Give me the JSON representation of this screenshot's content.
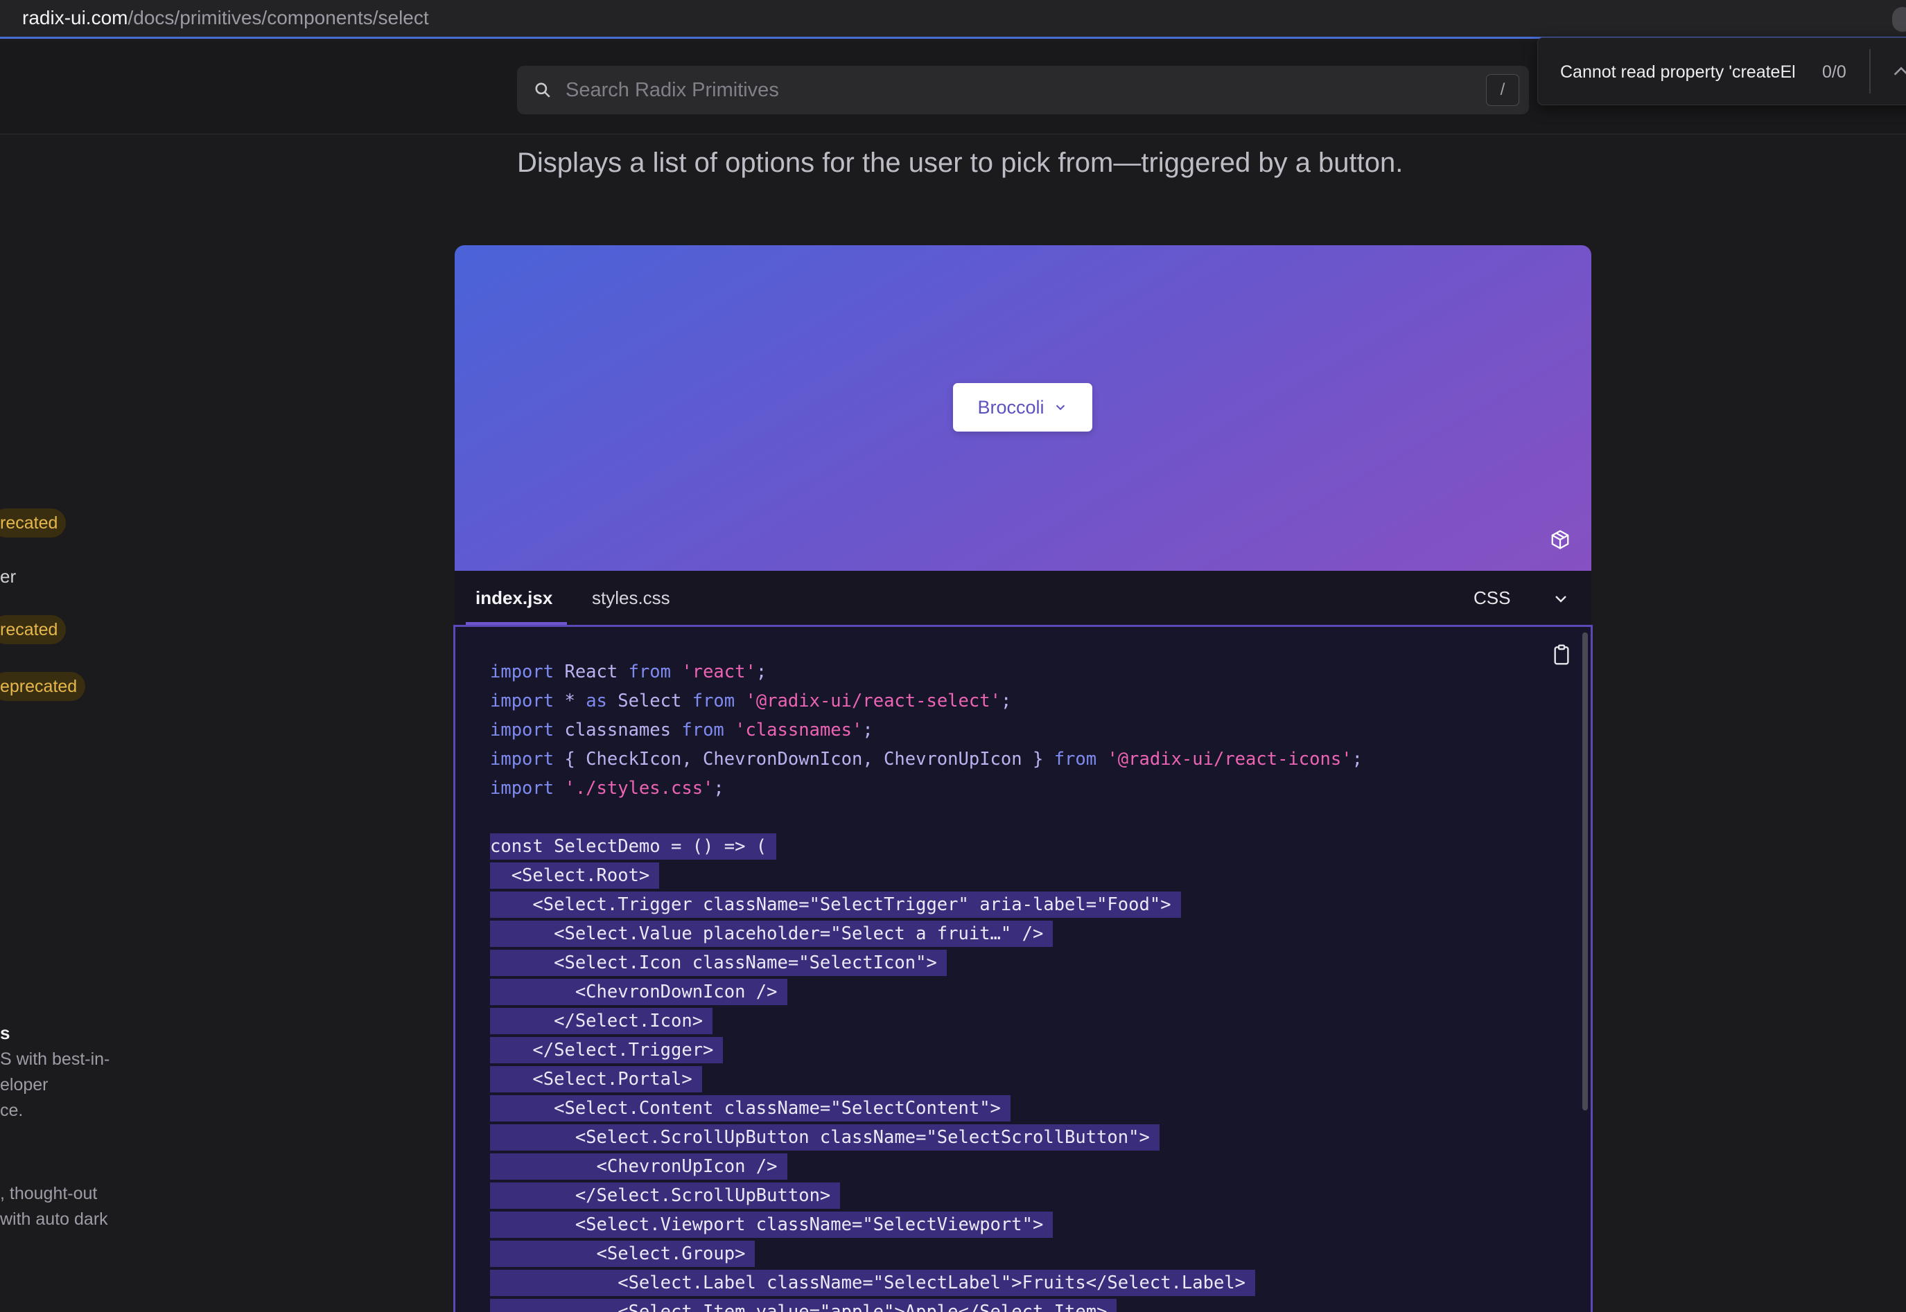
{
  "browser": {
    "url_host": "radix-ui.com",
    "url_path": "/docs/primitives/components/select"
  },
  "header": {
    "search_placeholder": "Search Radix Primitives",
    "search_shortcut": "/"
  },
  "toast": {
    "message": "Cannot read property 'createEl",
    "count": "0/0"
  },
  "sidebar": {
    "badge_1": "recated",
    "item_er": "er",
    "badge_2": "recated",
    "badge_3": "eprecated",
    "card_1_title": "s",
    "card_1_lines": [
      "S with best-in-",
      "eloper",
      "ce."
    ],
    "card_2_lines": [
      ", thought-out",
      "with auto dark"
    ]
  },
  "page": {
    "description": "Displays a list of options for the user to pick from—triggered by a button."
  },
  "demo": {
    "trigger_label": "Broccoli",
    "gradient_colors": [
      "#4b63d8",
      "#6a56cc",
      "#8651c2"
    ]
  },
  "code_tabs": {
    "tabs": [
      "index.jsx",
      "styles.css"
    ],
    "active_tab": "index.jsx",
    "language": "CSS"
  },
  "code": {
    "imports": [
      [
        {
          "t": "import ",
          "c": "kw"
        },
        {
          "t": "React ",
          "c": "plain"
        },
        {
          "t": "from ",
          "c": "kw"
        },
        {
          "t": "'react'",
          "c": "str"
        },
        {
          "t": ";",
          "c": "plain"
        }
      ],
      [
        {
          "t": "import ",
          "c": "kw"
        },
        {
          "t": "* ",
          "c": "plain"
        },
        {
          "t": "as ",
          "c": "kw"
        },
        {
          "t": "Select ",
          "c": "plain"
        },
        {
          "t": "from ",
          "c": "kw"
        },
        {
          "t": "'@radix-ui/react-select'",
          "c": "str"
        },
        {
          "t": ";",
          "c": "plain"
        }
      ],
      [
        {
          "t": "import ",
          "c": "kw"
        },
        {
          "t": "classnames ",
          "c": "plain"
        },
        {
          "t": "from ",
          "c": "kw"
        },
        {
          "t": "'classnames'",
          "c": "str"
        },
        {
          "t": ";",
          "c": "plain"
        }
      ],
      [
        {
          "t": "import ",
          "c": "kw"
        },
        {
          "t": "{ CheckIcon, ChevronDownIcon, ChevronUpIcon } ",
          "c": "plain"
        },
        {
          "t": "from ",
          "c": "kw"
        },
        {
          "t": "'@radix-ui/react-icons'",
          "c": "str"
        },
        {
          "t": ";",
          "c": "plain"
        }
      ],
      [
        {
          "t": "import ",
          "c": "kw"
        },
        {
          "t": "'./styles.css'",
          "c": "str"
        },
        {
          "t": ";",
          "c": "plain"
        }
      ]
    ],
    "highlighted": [
      "const SelectDemo = () => (",
      "  <Select.Root>",
      "    <Select.Trigger className=\"SelectTrigger\" aria-label=\"Food\">",
      "      <Select.Value placeholder=\"Select a fruit…\" />",
      "      <Select.Icon className=\"SelectIcon\">",
      "        <ChevronDownIcon />",
      "      </Select.Icon>",
      "    </Select.Trigger>",
      "    <Select.Portal>",
      "      <Select.Content className=\"SelectContent\">",
      "        <Select.ScrollUpButton className=\"SelectScrollButton\">",
      "          <ChevronUpIcon />",
      "        </Select.ScrollUpButton>",
      "        <Select.Viewport className=\"SelectViewport\">",
      "          <Select.Group>",
      "            <Select.Label className=\"SelectLabel\">Fruits</Select.Label>",
      "            <Select.Item value=\"apple\">Apple</Select.Item>"
    ]
  }
}
